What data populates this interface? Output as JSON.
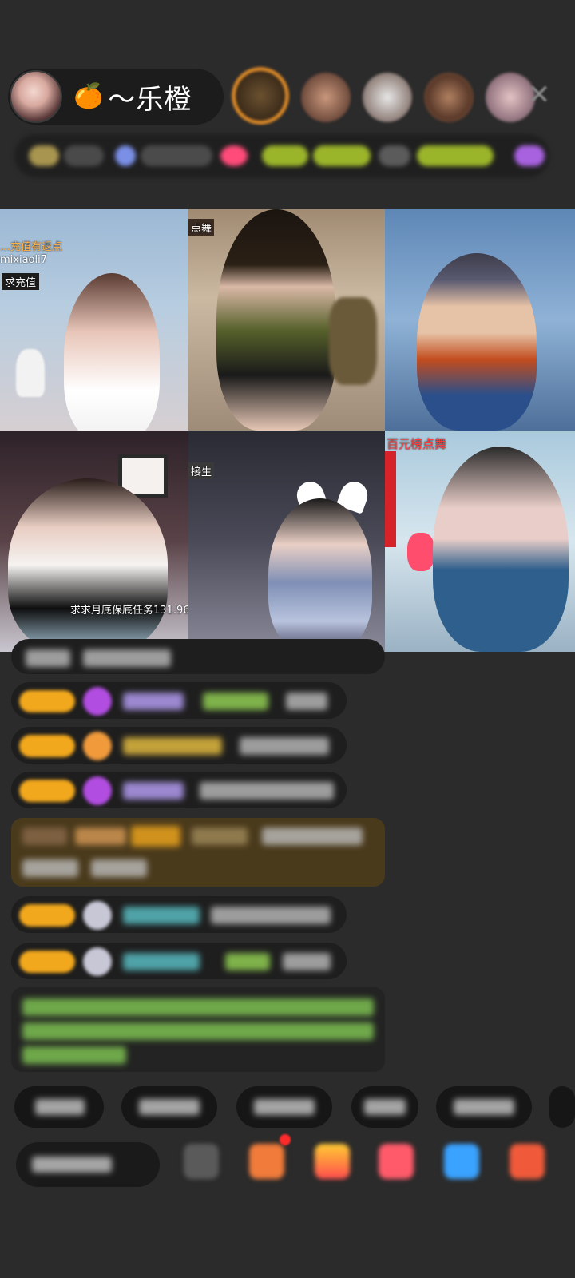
{
  "host": {
    "emoji": "🍊",
    "name": "～乐橙"
  },
  "viewers": [
    "viewer-1",
    "viewer-2",
    "viewer-3",
    "viewer-4",
    "viewer-5"
  ],
  "close_icon": "✕",
  "tiles": [
    {
      "captions": [
        {
          "text": "…充值有返点"
        },
        {
          "text": "mixiaoli7"
        },
        {
          "text": "求充值"
        }
      ]
    },
    {
      "captions": [
        {
          "text": "点舞"
        }
      ]
    },
    {
      "captions": []
    },
    {
      "captions": [
        {
          "text": "求求月底保底任务131.96"
        }
      ]
    },
    {
      "captions": [
        {
          "text": "接生"
        }
      ]
    },
    {
      "captions": [
        {
          "text": "百元榜点舞"
        }
      ]
    }
  ],
  "colors": {
    "background": "#2b2b2b",
    "level_badge": "#f2a81c",
    "caption_orange": "#ffb14a",
    "caption_red": "#ff3b3b"
  }
}
